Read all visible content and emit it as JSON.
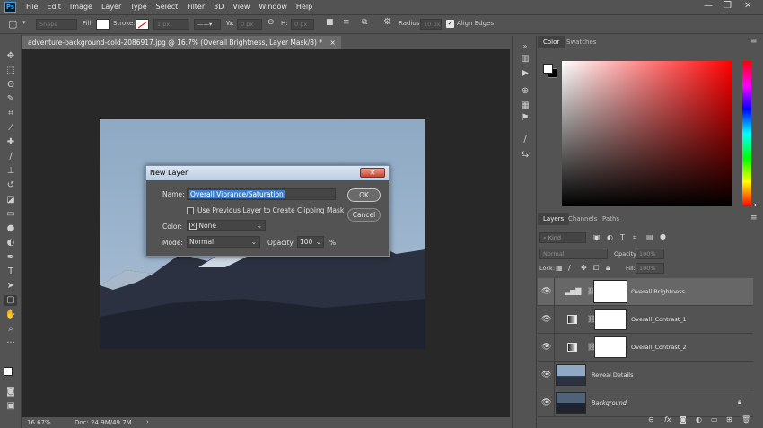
{
  "app": {
    "logo": "Ps",
    "menu": [
      "File",
      "Edit",
      "Image",
      "Layer",
      "Type",
      "Select",
      "Filter",
      "3D",
      "View",
      "Window",
      "Help"
    ],
    "window_controls": [
      "—",
      "❐",
      "✕"
    ]
  },
  "options_bar": {
    "shape_mode": "Shape",
    "fill_label": "Fill:",
    "stroke_label": "Stroke:",
    "stroke_size": "1 px",
    "w_label": "W:",
    "w_value": "0 px",
    "h_label": "H:",
    "h_value": "0 px",
    "radius_label": "Radius:",
    "radius_value": "10 px",
    "align_edges_label": "Align Edges",
    "align_edges_checked": true
  },
  "document": {
    "tab_title": "adventure-background-cold-2086917.jpg @ 16.7% (Overall Brightness, Layer Mask/8) *",
    "tab_close": "×",
    "zoom": "16.67%",
    "doc_info": "Doc: 24.9M/49.7M"
  },
  "dialog": {
    "title": "New Layer",
    "close_label": "✕",
    "name_label": "Name:",
    "name_value": "Overall Vibrance/Saturation",
    "clipping_label": "Use Previous Layer to Create Clipping Mask",
    "color_label": "Color:",
    "color_value": "None",
    "mode_label": "Mode:",
    "mode_value": "Normal",
    "opacity_label": "Opacity:",
    "opacity_value": "100",
    "opacity_unit": "%",
    "ok_label": "OK",
    "cancel_label": "Cancel"
  },
  "color_panel": {
    "tabs": [
      "Color",
      "Swatches"
    ],
    "foreground": "#ffffff",
    "background": "#000000"
  },
  "layers_panel": {
    "tabs": [
      "Layers",
      "Channels",
      "Paths"
    ],
    "filter_kind": "Kind",
    "blend_mode": "Normal",
    "opacity_label": "Opacity:",
    "opacity_value": "100%",
    "lock_label": "Lock:",
    "fill_label": "Fill:",
    "fill_value": "100%",
    "layers": [
      {
        "name": "Overall Brightness",
        "selected": true,
        "italic": false
      },
      {
        "name": "Overall_Contrast_1",
        "selected": false,
        "italic": false
      },
      {
        "name": "Overall_Contrast_2",
        "selected": false,
        "italic": false
      },
      {
        "name": "Reveal Details",
        "selected": false,
        "italic": false
      },
      {
        "name": "Background",
        "selected": false,
        "italic": true
      }
    ]
  },
  "colors": {
    "accent": "#31a8ff",
    "selection_highlight": "#3d7fcf"
  }
}
